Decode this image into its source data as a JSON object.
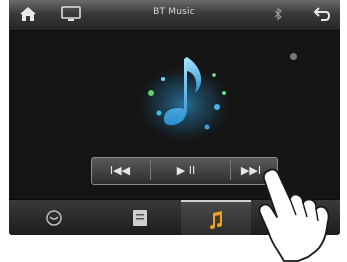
{
  "topbar": {
    "title": "BT Music",
    "icons": [
      "home-icon",
      "display-icon",
      "bluetooth-icon",
      "back-icon"
    ]
  },
  "player": {
    "artwork_icon": "music-note-icon",
    "controls": [
      {
        "name": "previous-track-button",
        "label": "I◀◀"
      },
      {
        "name": "play-pause-button",
        "label": "▶ II"
      },
      {
        "name": "next-track-button",
        "label": "▶▶I"
      }
    ]
  },
  "navbar": {
    "items": [
      {
        "name": "nav-phone",
        "icon": "phone-icon"
      },
      {
        "name": "nav-contacts",
        "icon": "contacts-icon"
      },
      {
        "name": "nav-music",
        "icon": "music-note-icon",
        "active": true
      },
      {
        "name": "nav-settings",
        "icon": "settings-icon"
      }
    ]
  },
  "colors": {
    "accent": "#f0a020",
    "note": "#3ab8e8",
    "background": "#141414"
  }
}
